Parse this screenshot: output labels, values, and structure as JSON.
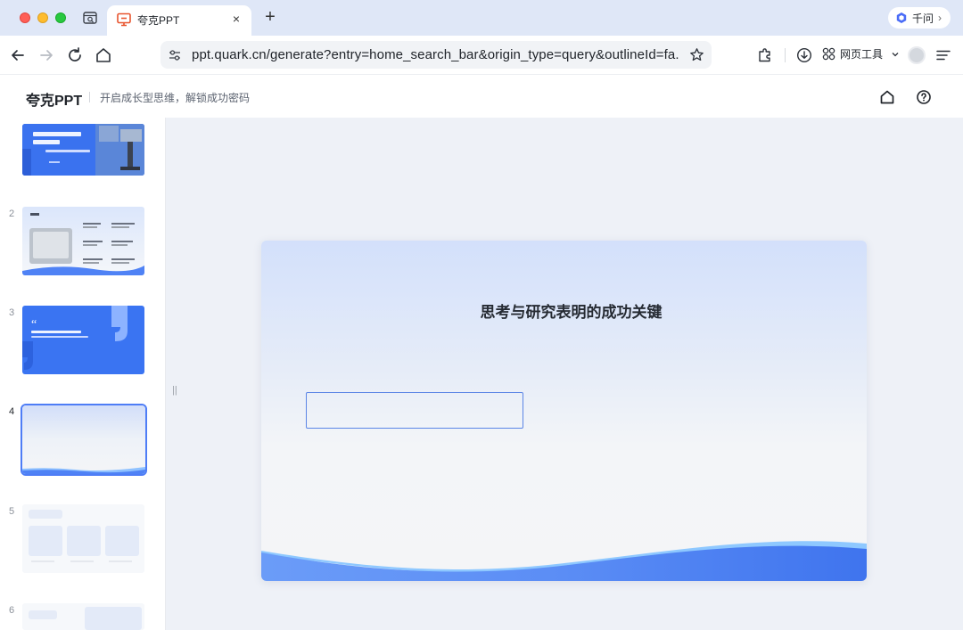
{
  "browser": {
    "tab": {
      "title": "夸克PPT",
      "favicon": "ppt-presentation-icon",
      "close": "×"
    },
    "new_tab": "+",
    "qianwen_label": "千问",
    "qianwen_arrow": "›",
    "url": "ppt.quark.cn/generate?entry=home_search_bar&origin_type=query&outlineId=fa...",
    "web_tools_label": "网页工具",
    "icons": [
      "tab-overview-icon",
      "back-arrow-icon",
      "forward-arrow-icon",
      "reload-icon",
      "home-icon",
      "site-settings-icon",
      "bookmark-star-icon",
      "extensions-icon",
      "download-icon",
      "web-tools-grid-icon",
      "chevron-down-icon",
      "profile-avatar",
      "menu-icon"
    ]
  },
  "app": {
    "brand": "夸克PPT",
    "doc_title": "开启成长型思维，解锁成功密码",
    "icons": [
      "home-icon",
      "help-icon"
    ]
  },
  "sidebar": {
    "slides": [
      {
        "number": "",
        "kind": "cover"
      },
      {
        "number": "2",
        "kind": "contents"
      },
      {
        "number": "3",
        "kind": "section"
      },
      {
        "number": "4",
        "kind": "content",
        "active": true
      },
      {
        "number": "5",
        "kind": "placeholder"
      },
      {
        "number": "6",
        "kind": "placeholder"
      }
    ],
    "resize_handle": "||"
  },
  "slide": {
    "title": "思考与研究表明的成功关键",
    "textbox_value": "",
    "colors": {
      "wave_dark": "#4f82f5",
      "wave_light": "#8ec1ff",
      "textbox_border": "#5b85e6"
    }
  }
}
